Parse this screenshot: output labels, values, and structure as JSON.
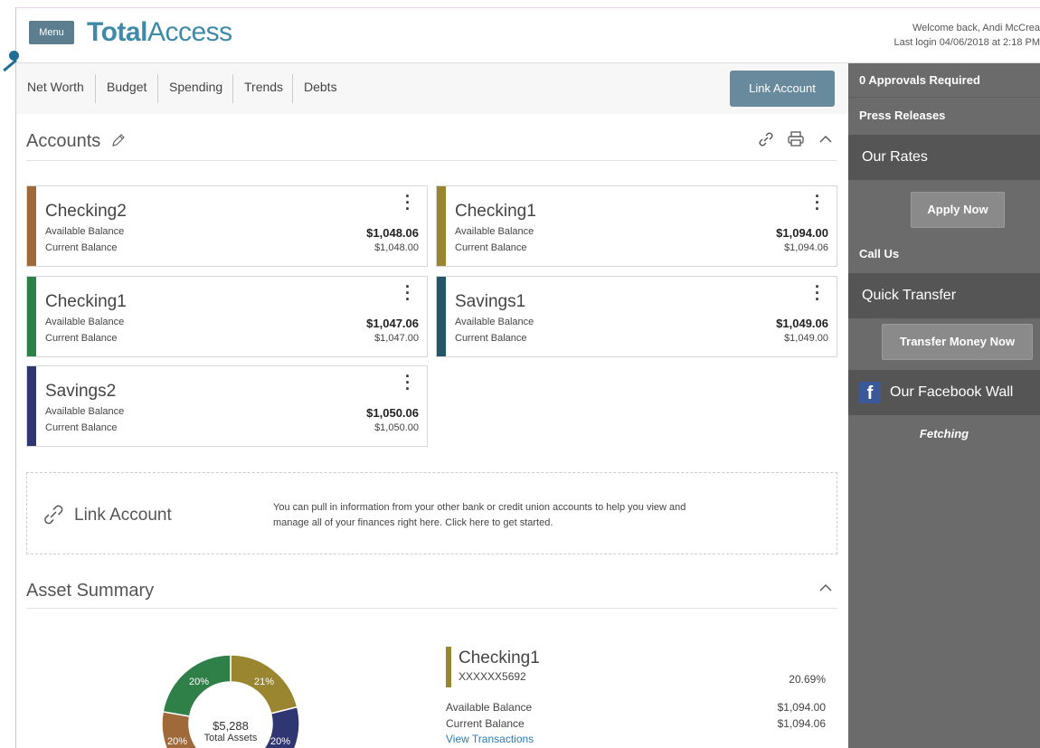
{
  "header": {
    "menu_label": "Menu",
    "brand_bold": "Total",
    "brand_light": "Access",
    "welcome": "Welcome back, Andi McCrea",
    "last_login": "Last login 04/06/2018 at 2:18 PM"
  },
  "nav": {
    "items": [
      "Net Worth",
      "Budget",
      "Spending",
      "Trends",
      "Debts"
    ],
    "link_account_button": "Link Account"
  },
  "accounts": {
    "title": "Accounts",
    "cards": [
      {
        "name": "Checking2",
        "available_label": "Available Balance",
        "current_label": "Current Balance",
        "available": "$1,048.06",
        "current": "$1,048.00",
        "color": "#a0693a"
      },
      {
        "name": "Checking1",
        "available_label": "Available Balance",
        "current_label": "Current Balance",
        "available": "$1,094.00",
        "current": "$1,094.06",
        "color": "#9a8630"
      },
      {
        "name": "Checking1",
        "available_label": "Available Balance",
        "current_label": "Current Balance",
        "available": "$1,047.06",
        "current": "$1,047.00",
        "color": "#2e7f48"
      },
      {
        "name": "Savings1",
        "available_label": "Available Balance",
        "current_label": "Current Balance",
        "available": "$1,049.06",
        "current": "$1,049.00",
        "color": "#24566a"
      },
      {
        "name": "Savings2",
        "available_label": "Available Balance",
        "current_label": "Current Balance",
        "available": "$1,050.06",
        "current": "$1,050.00",
        "color": "#2f3672"
      }
    ]
  },
  "link_panel": {
    "title": "Link Account",
    "description": "You can pull in information from your other bank or credit union accounts to help you view and manage all of your finances right here. Click here to get started."
  },
  "asset_summary": {
    "title": "Asset Summary",
    "total_value": "$5,288",
    "total_label": "Total Assets",
    "detail": {
      "name": "Checking1",
      "account_number": "XXXXXX5692",
      "percent": "20.69%",
      "available_label": "Available Balance",
      "available": "$1,094.00",
      "current_label": "Current Balance",
      "current": "$1,094.06",
      "link": "View Transactions"
    }
  },
  "chart_data": {
    "type": "pie",
    "categories": [
      "Checking1",
      "Savings2",
      "Checking2",
      "Checking1"
    ],
    "values": [
      21,
      20,
      20,
      20
    ],
    "labels": [
      "21%",
      "20%",
      "20%",
      "20%"
    ],
    "colors": [
      "#9a8630",
      "#2f3672",
      "#a0693a",
      "#2e7f48"
    ],
    "center_value": "$5,288",
    "center_label": "Total Assets"
  },
  "sidebar": {
    "approvals": "0 Approvals Required",
    "press_releases": "Press Releases",
    "our_rates": "Our Rates",
    "apply_now": "Apply Now",
    "call_us": "Call Us",
    "quick_transfer": "Quick Transfer",
    "transfer_money_now": "Transfer Money Now",
    "facebook_wall": "Our Facebook Wall",
    "fetching": "Fetching"
  }
}
